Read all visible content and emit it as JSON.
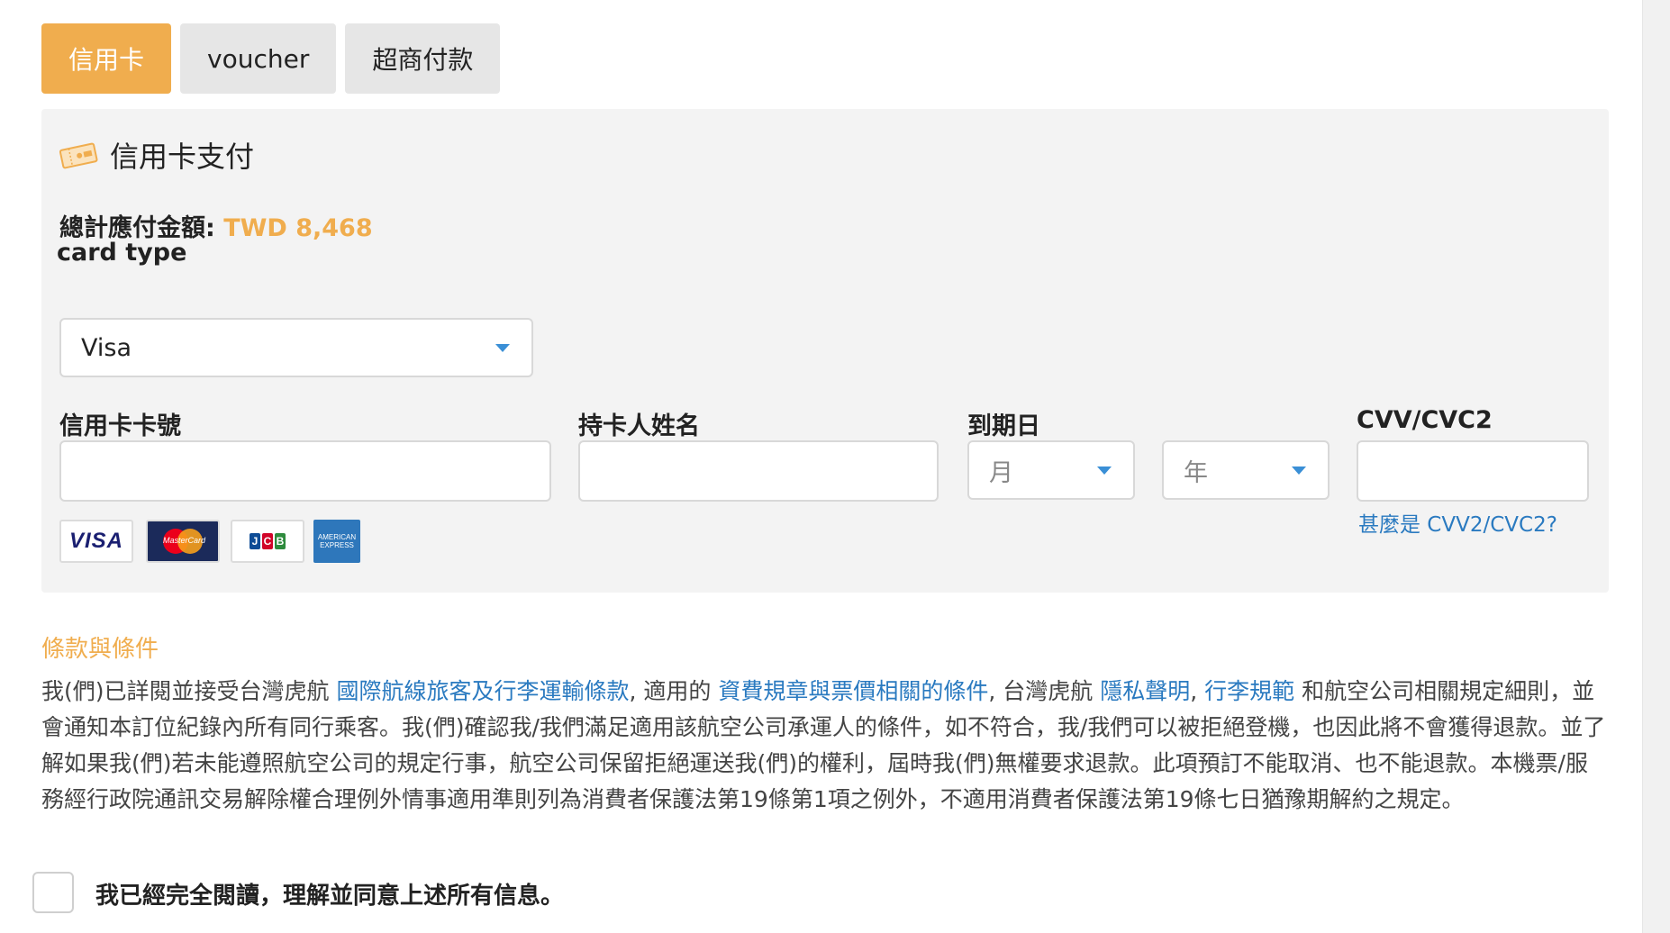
{
  "tabs": [
    {
      "label": "信用卡",
      "active": true
    },
    {
      "label": "voucher",
      "active": false
    },
    {
      "label": "超商付款",
      "active": false
    }
  ],
  "panel": {
    "title": "信用卡支付",
    "icon": "ticket-icon",
    "total_label": "總計應付金額:",
    "total_amount": "TWD 8,468"
  },
  "card_type": {
    "label": "card type",
    "value": "Visa"
  },
  "fields": {
    "card_number_label": "信用卡卡號",
    "card_number_value": "",
    "holder_label": "持卡人姓名",
    "holder_value": "",
    "expiry_label": "到期日",
    "expiry_month_placeholder": "月",
    "expiry_year_placeholder": "年",
    "cvv_label": "CVV/CVC2",
    "cvv_value": "",
    "cvv_help": "甚麼是 CVV2/CVC2?"
  },
  "card_logos": [
    "VISA",
    "MasterCard",
    "JCB",
    "AMERICAN EXPRESS"
  ],
  "terms": {
    "heading": "條款與條件",
    "t1": "我(們)已詳閱並接受台灣虎航 ",
    "link1": "國際航線旅客及行李運輸條款",
    "t2": ", 適用的 ",
    "link2": "資費規章與票價相關的條件",
    "t3": ", 台灣虎航 ",
    "link3": "隱私聲明",
    "t4": ", ",
    "link4": "行李規範",
    "t5": " 和航空公司相關規定細則，並會通知本訂位紀錄內所有同行乘客。我(們)確認我/我們滿足適用該航空公司承運人的條件，如不符合，我/我們可以被拒絕登機，也因此將不會獲得退款。並了解如果我(們)若未能遵照航空公司的規定行事，航空公司保留拒絕運送我(們)的權利，屆時我(們)無權要求退款。此項預訂不能取消、也不能退款。本機票/服務經行政院通訊交易解除權合理例外情事適用準則列為消費者保護法第19條第1項之例外，不適用消費者保護法第19條七日猶豫期解約之規定。"
  },
  "agree": {
    "checked": false,
    "label": "我已經完全閱讀，理解並同意上述所有信息。"
  },
  "colors": {
    "accent": "#f0ad4e",
    "link": "#2a7ac0",
    "panel_bg": "#f3f3f3"
  }
}
